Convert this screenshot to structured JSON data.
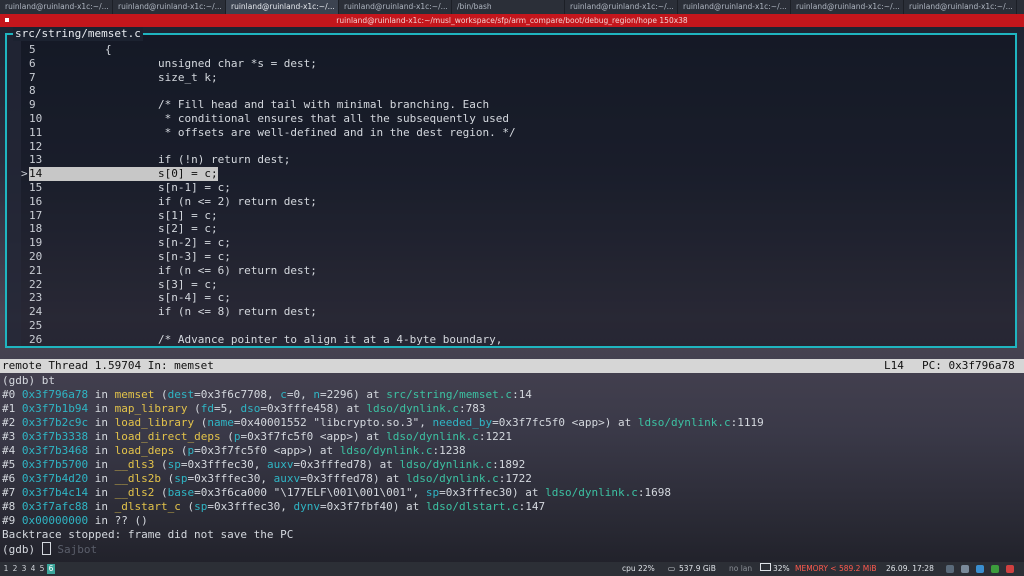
{
  "tabs": [
    {
      "label": "ruinland@ruinland-x1c:~/...",
      "active": false
    },
    {
      "label": "ruinland@ruinland-x1c:~/...",
      "active": false
    },
    {
      "label": "ruinland@ruinland-x1c:~/...",
      "active": true
    },
    {
      "label": "ruinland@ruinland-x1c:~/...",
      "active": false
    },
    {
      "label": "/bin/bash",
      "active": false
    },
    {
      "label": "ruinland@ruinland-x1c:~/...",
      "active": false
    },
    {
      "label": "ruinland@ruinland-x1c:~/...",
      "active": false
    },
    {
      "label": "ruinland@ruinland-x1c:~/...",
      "active": false
    },
    {
      "label": "ruinland@ruinland-x1c:~/...",
      "active": false
    }
  ],
  "window_title": "ruinland@ruinland-x1c:~/musl_workspace/sfp/arm_compare/boot/debug_region/hope 150x38",
  "source": {
    "filename": "src/string/memset.c",
    "lines": [
      {
        "n": "5",
        "code": "{"
      },
      {
        "n": "6",
        "code": "        unsigned char *s = dest;"
      },
      {
        "n": "7",
        "code": "        size_t k;"
      },
      {
        "n": "8",
        "code": ""
      },
      {
        "n": "9",
        "code": "        /* Fill head and tail with minimal branching. Each"
      },
      {
        "n": "10",
        "code": "         * conditional ensures that all the subsequently used"
      },
      {
        "n": "11",
        "code": "         * offsets are well-defined and in the dest region. */"
      },
      {
        "n": "12",
        "code": ""
      },
      {
        "n": "13",
        "code": "        if (!n) return dest;"
      },
      {
        "n": "14",
        "code": "        s[0] = c;",
        "current": true
      },
      {
        "n": "15",
        "code": "        s[n-1] = c;"
      },
      {
        "n": "16",
        "code": "        if (n <= 2) return dest;"
      },
      {
        "n": "17",
        "code": "        s[1] = c;"
      },
      {
        "n": "18",
        "code": "        s[2] = c;"
      },
      {
        "n": "19",
        "code": "        s[n-2] = c;"
      },
      {
        "n": "20",
        "code": "        s[n-3] = c;"
      },
      {
        "n": "21",
        "code": "        if (n <= 6) return dest;"
      },
      {
        "n": "22",
        "code": "        s[3] = c;"
      },
      {
        "n": "23",
        "code": "        s[n-4] = c;"
      },
      {
        "n": "24",
        "code": "        if (n <= 8) return dest;"
      },
      {
        "n": "25",
        "code": ""
      },
      {
        "n": "26",
        "code": "        /* Advance pointer to align it at a 4-byte boundary,"
      }
    ]
  },
  "status": {
    "left": "remote Thread 1.59704 In: memset",
    "line": "L14",
    "pc": "PC: 0x3f796a78"
  },
  "gdb": {
    "prompt_bt": "(gdb) bt",
    "frames": [
      {
        "idx": "#0 ",
        "addr": "0x3f796a78",
        "fn": "memset",
        "args": [
          [
            "dest",
            "0x3f6c7708"
          ],
          [
            "c",
            "0"
          ],
          [
            "n",
            "2296"
          ]
        ],
        "file": "src/string/memset.c",
        "line": "14"
      },
      {
        "idx": "#1 ",
        "addr": "0x3f7b1b94",
        "fn": "map_library",
        "args": [
          [
            "fd",
            "5"
          ],
          [
            "dso",
            "0x3fffe458"
          ]
        ],
        "file": "ldso/dynlink.c",
        "line": "783"
      },
      {
        "idx": "#2 ",
        "addr": "0x3f7b2c9c",
        "fn": "load_library",
        "args": [
          [
            "name",
            "0x40001552 \"libcrypto.so.3\""
          ],
          [
            "needed_by",
            "0x3f7fc5f0 <app>"
          ]
        ],
        "file": "ldso/dynlink.c",
        "line": "1119"
      },
      {
        "idx": "#3 ",
        "addr": "0x3f7b3338",
        "fn": "load_direct_deps",
        "args": [
          [
            "p",
            "0x3f7fc5f0 <app>"
          ]
        ],
        "file": "ldso/dynlink.c",
        "line": "1221"
      },
      {
        "idx": "#4 ",
        "addr": "0x3f7b3468",
        "fn": "load_deps",
        "args": [
          [
            "p",
            "0x3f7fc5f0 <app>"
          ]
        ],
        "file": "ldso/dynlink.c",
        "line": "1238"
      },
      {
        "idx": "#5 ",
        "addr": "0x3f7b5700",
        "fn": "__dls3",
        "args": [
          [
            "sp",
            "0x3fffec30"
          ],
          [
            "auxv",
            "0x3fffed78"
          ]
        ],
        "file": "ldso/dynlink.c",
        "line": "1892"
      },
      {
        "idx": "#6 ",
        "addr": "0x3f7b4d20",
        "fn": "__dls2b",
        "args": [
          [
            "sp",
            "0x3fffec30"
          ],
          [
            "auxv",
            "0x3fffed78"
          ]
        ],
        "file": "ldso/dynlink.c",
        "line": "1722"
      },
      {
        "idx": "#7 ",
        "addr": "0x3f7b4c14",
        "fn": "__dls2",
        "args": [
          [
            "base",
            "0x3f6ca000 \"\\177ELF\\001\\001\\001\""
          ],
          [
            "sp",
            "0x3fffec30"
          ]
        ],
        "file": "ldso/dynlink.c",
        "line": "1698"
      },
      {
        "idx": "#8 ",
        "addr": "0x3f7afc88",
        "fn": "_dlstart_c",
        "args": [
          [
            "sp",
            "0x3fffec30"
          ],
          [
            "dynv",
            "0x3f7fbf40"
          ]
        ],
        "file": "ldso/dlstart.c",
        "line": "147"
      }
    ],
    "frame9": {
      "idx": "#9 ",
      "addr": "0x00000000",
      "text": " in ?? ()"
    },
    "stopped": "Backtrace stopped: frame did not save the PC",
    "prompt": "(gdb) ",
    "ghost": "Sajbot"
  },
  "bottombar": {
    "workspaces": [
      "1",
      "2",
      "3",
      "4",
      "5",
      "6"
    ],
    "active_workspace": "6",
    "cpu": "cpu  22%",
    "disk": "537.9 GiB",
    "lan": "no lan",
    "battery": "32%",
    "memory": "MEMORY < 589.2 MiB",
    "datetime": "26.09. 17:28"
  }
}
